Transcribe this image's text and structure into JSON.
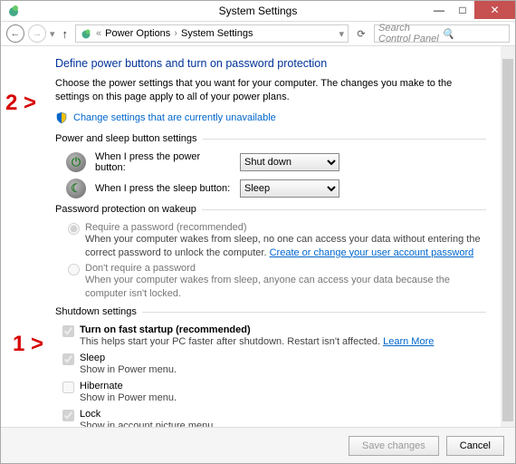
{
  "window": {
    "title": "System Settings"
  },
  "nav": {
    "breadcrumb": [
      "Power Options",
      "System Settings"
    ],
    "search_placeholder": "Search Control Panel"
  },
  "heading": "Define power buttons and turn on password protection",
  "desc": "Choose the power settings that you want for your computer. The changes you make to the settings on this page apply to all of your power plans.",
  "admin_link": "Change settings that are currently unavailable",
  "section_buttons": {
    "title": "Power and sleep button settings",
    "power_label": "When I press the power button:",
    "power_value": "Shut down",
    "sleep_label": "When I press the sleep button:",
    "sleep_value": "Sleep"
  },
  "section_password": {
    "title": "Password protection on wakeup",
    "opt1_title": "Require a password (recommended)",
    "opt1_sub_a": "When your computer wakes from sleep, no one can access your data without entering the correct password to unlock the computer. ",
    "opt1_link": "Create or change your user account password",
    "opt2_title": "Don't require a password",
    "opt2_sub": "When your computer wakes from sleep, anyone can access your data because the computer isn't locked."
  },
  "section_shutdown": {
    "title": "Shutdown settings",
    "fast_title": "Turn on fast startup (recommended)",
    "fast_sub": "This helps start your PC faster after shutdown. Restart isn't affected. ",
    "fast_link": "Learn More",
    "sleep_title": "Sleep",
    "sleep_sub": "Show in Power menu.",
    "hib_title": "Hibernate",
    "hib_sub": "Show in Power menu.",
    "lock_title": "Lock",
    "lock_sub": "Show in account picture menu."
  },
  "footer": {
    "save": "Save changes",
    "cancel": "Cancel"
  },
  "annotations": {
    "a1": "1 >",
    "a2": "2 >"
  }
}
